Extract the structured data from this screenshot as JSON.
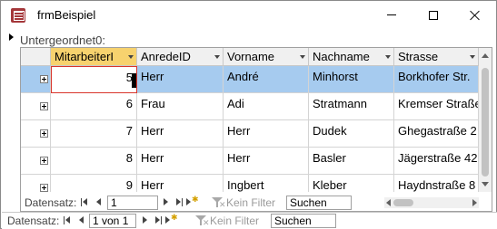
{
  "window": {
    "title": "frmBeispiel"
  },
  "subform": {
    "label": "Untergeordnet0:"
  },
  "table": {
    "columns": [
      "MitarbeiterI",
      "AnredeID",
      "Vorname",
      "Nachname",
      "Strasse"
    ],
    "rows": [
      {
        "id": "5",
        "anrede": "Herr",
        "vorname": "André",
        "nachname": "Minhorst",
        "strasse": "Borkhofer Str."
      },
      {
        "id": "6",
        "anrede": "Frau",
        "vorname": "Adi",
        "nachname": "Stratmann",
        "strasse": "Kremser Straße"
      },
      {
        "id": "7",
        "anrede": "Herr",
        "vorname": "Herr",
        "nachname": "Dudek",
        "strasse": "Ghegastraße 2"
      },
      {
        "id": "8",
        "anrede": "Herr",
        "vorname": "Herr",
        "nachname": "Basler",
        "strasse": "Jägerstraße 42"
      },
      {
        "id": "9",
        "anrede": "Herr",
        "vorname": "Ingbert",
        "nachname": "Kleber",
        "strasse": "Haydnstraße 8"
      }
    ]
  },
  "subnav": {
    "label": "Datensatz:",
    "current": "1",
    "filter_label": "Kein Filter",
    "search_placeholder": "Suchen"
  },
  "mainnav": {
    "label": "Datensatz:",
    "current": "1 von 1",
    "filter_label": "Kein Filter",
    "search_placeholder": "Suchen"
  },
  "colors": {
    "selected_row": "#a6cbef",
    "active_header": "#f7d26e",
    "focus_border": "#d9342b",
    "app_icon": "#a4373a"
  }
}
